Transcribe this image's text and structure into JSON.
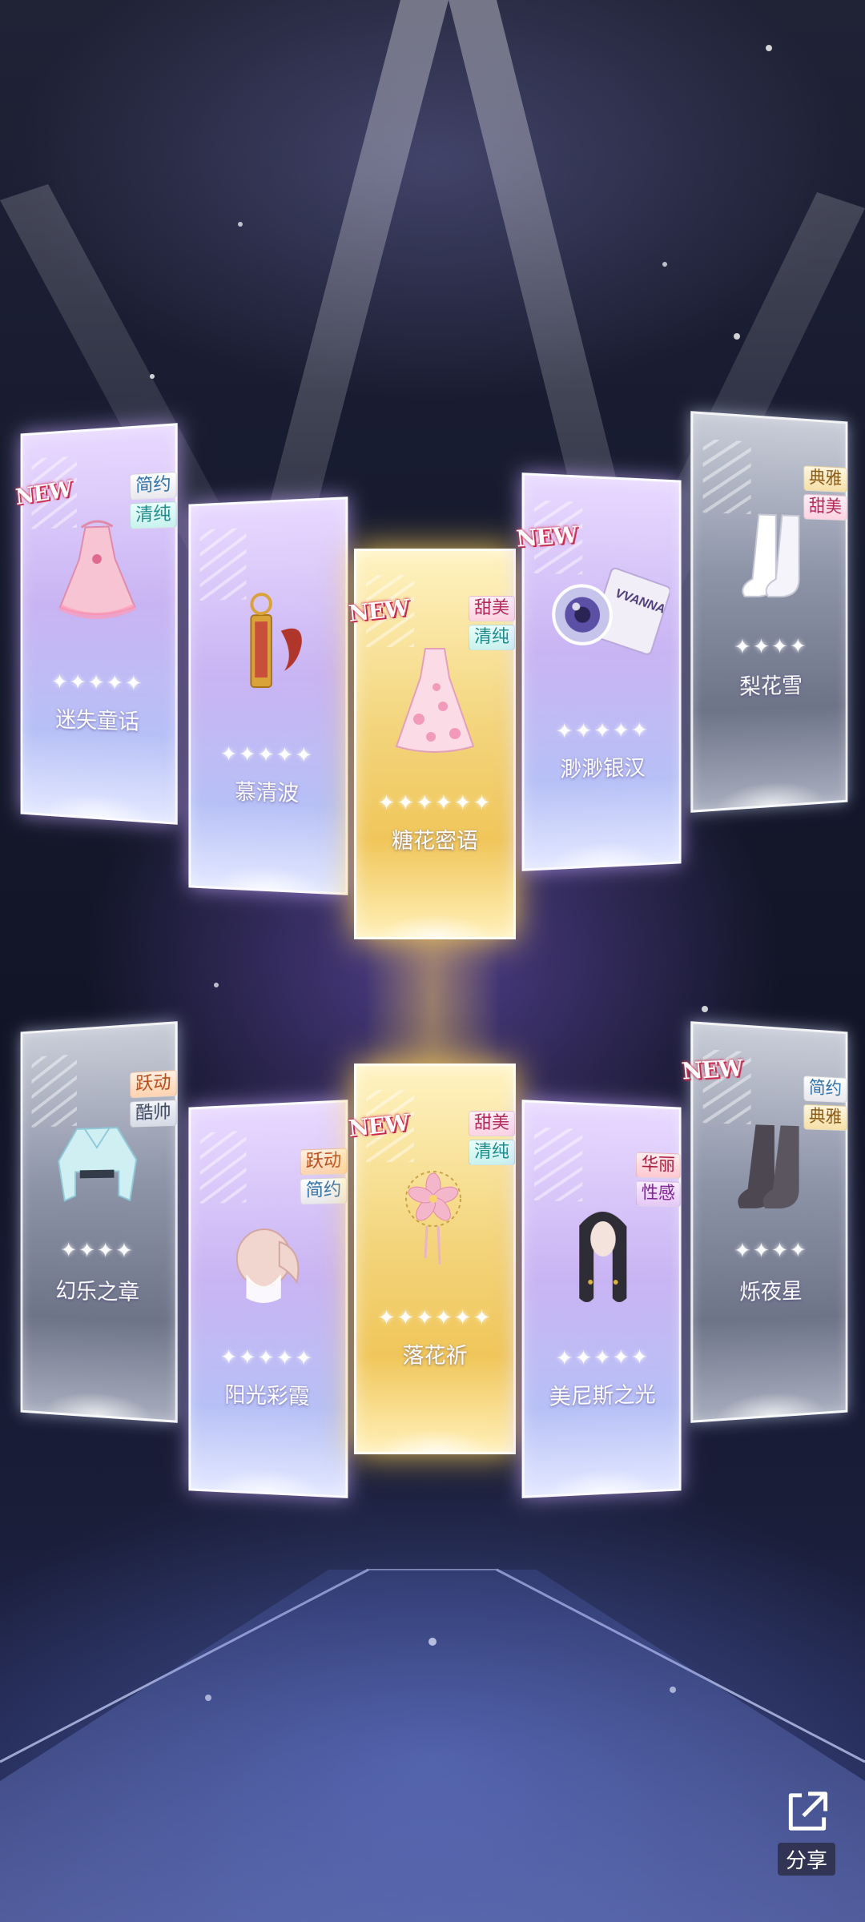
{
  "cards": [
    {
      "id": "c1",
      "rarity": "purple",
      "new": "NEW",
      "tags": [
        {
          "text": "简约",
          "style": "t-simple"
        },
        {
          "text": "清纯",
          "style": "t-pure"
        }
      ],
      "stars": "✦✦✦✦✦",
      "name": "迷失童话",
      "art": "dress-icon"
    },
    {
      "id": "c2",
      "rarity": "purple",
      "new": "",
      "tags": [],
      "stars": "✦✦✦✦✦",
      "name": "慕清波",
      "art": "lipstick-icon"
    },
    {
      "id": "c3",
      "rarity": "gold",
      "new": "NEW",
      "tags": [
        {
          "text": "甜美",
          "style": "t-sweet"
        },
        {
          "text": "清纯",
          "style": "t-pure"
        }
      ],
      "stars": "✦✦✦✦✦✦",
      "name": "糖花密语",
      "art": "gown-icon"
    },
    {
      "id": "c4",
      "rarity": "purple",
      "new": "NEW",
      "tags": [],
      "stars": "✦✦✦✦✦",
      "name": "渺渺银汉",
      "art": "contact-lens-icon",
      "art_label": "VVANNA"
    },
    {
      "id": "c5",
      "rarity": "gray",
      "new": "",
      "tags": [
        {
          "text": "典雅",
          "style": "t-elegant"
        },
        {
          "text": "甜美",
          "style": "t-sweet"
        }
      ],
      "stars": "✦✦✦✦",
      "name": "梨花雪",
      "art": "stockings-icon"
    },
    {
      "id": "c6",
      "rarity": "gray",
      "new": "",
      "tags": [
        {
          "text": "跃动",
          "style": "t-lively"
        },
        {
          "text": "酷帅",
          "style": "t-cool"
        }
      ],
      "stars": "✦✦✦✦",
      "name": "幻乐之章",
      "art": "jacket-icon"
    },
    {
      "id": "c7",
      "rarity": "purple",
      "new": "",
      "tags": [
        {
          "text": "跃动",
          "style": "t-lively"
        },
        {
          "text": "简约",
          "style": "t-simple"
        }
      ],
      "stars": "✦✦✦✦✦",
      "name": "阳光彩霞",
      "art": "hair-icon"
    },
    {
      "id": "c8",
      "rarity": "gold",
      "new": "NEW",
      "tags": [
        {
          "text": "甜美",
          "style": "t-sweet"
        },
        {
          "text": "清纯",
          "style": "t-pure"
        }
      ],
      "stars": "✦✦✦✦✦✦",
      "name": "落花祈",
      "art": "flower-hairpin-icon"
    },
    {
      "id": "c9",
      "rarity": "purple",
      "new": "",
      "tags": [
        {
          "text": "华丽",
          "style": "t-gorgeous"
        },
        {
          "text": "性感",
          "style": "t-sexy"
        }
      ],
      "stars": "✦✦✦✦✦",
      "name": "美尼斯之光",
      "art": "long-hair-icon"
    },
    {
      "id": "c10",
      "rarity": "gray",
      "new": "NEW",
      "tags": [
        {
          "text": "简约",
          "style": "t-simple"
        },
        {
          "text": "典雅",
          "style": "t-elegant"
        }
      ],
      "stars": "✦✦✦✦",
      "name": "烁夜星",
      "art": "dark-stockings-icon"
    }
  ],
  "share": {
    "label": "分享",
    "icon": "share-icon"
  },
  "colors": {
    "gold": "#f3d57d",
    "purple": "#c9b4f3",
    "gray": "#8d94a8",
    "new_badge": "#e24060"
  }
}
